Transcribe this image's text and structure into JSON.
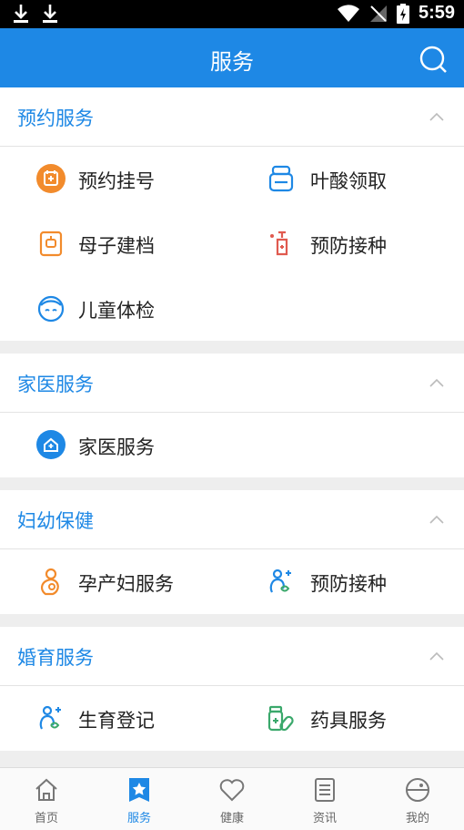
{
  "status": {
    "time": "5:59"
  },
  "header": {
    "title": "服务"
  },
  "sections": [
    {
      "title": "预约服务",
      "items": [
        "预约挂号",
        "叶酸领取",
        "母子建档",
        "预防接种",
        "儿童体检"
      ]
    },
    {
      "title": "家医服务",
      "items": [
        "家医服务"
      ]
    },
    {
      "title": "妇幼保健",
      "items": [
        "孕产妇服务",
        "预防接种"
      ]
    },
    {
      "title": "婚育服务",
      "items": [
        "生育登记",
        "药具服务"
      ]
    }
  ],
  "nav": [
    "首页",
    "服务",
    "健康",
    "资讯",
    "我的"
  ],
  "colors": {
    "accent": "#1e88e5",
    "orange": "#f28b2c",
    "red": "#e05a4f",
    "green": "#3aa86b"
  }
}
